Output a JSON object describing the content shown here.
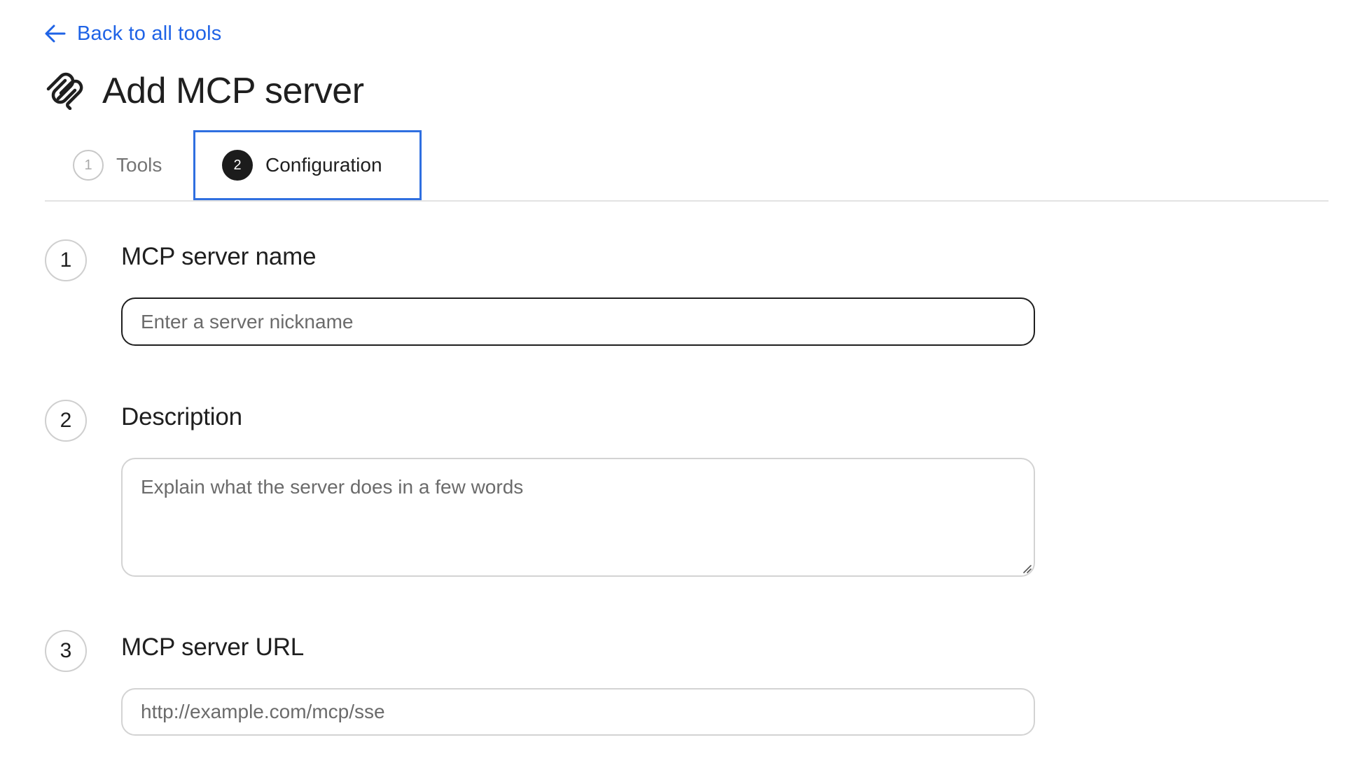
{
  "nav": {
    "back_label": "Back to all tools"
  },
  "header": {
    "title": "Add MCP server",
    "icon": "mcp-logo-icon"
  },
  "tabs": [
    {
      "number": "1",
      "label": "Tools",
      "active": false
    },
    {
      "number": "2",
      "label": "Configuration",
      "active": true
    }
  ],
  "steps": [
    {
      "number": "1",
      "heading": "MCP server name",
      "placeholder": "Enter a server nickname",
      "value": ""
    },
    {
      "number": "2",
      "heading": "Description",
      "placeholder": "Explain what the server does in a few words",
      "value": ""
    },
    {
      "number": "3",
      "heading": "MCP server URL",
      "placeholder": "http://example.com/mcp/sse",
      "value": ""
    }
  ],
  "colors": {
    "link": "#1f63e6",
    "focus_outline": "#2f6fe0",
    "text": "#1f1f1f",
    "muted": "#757575",
    "border": "#d3d3d3"
  }
}
